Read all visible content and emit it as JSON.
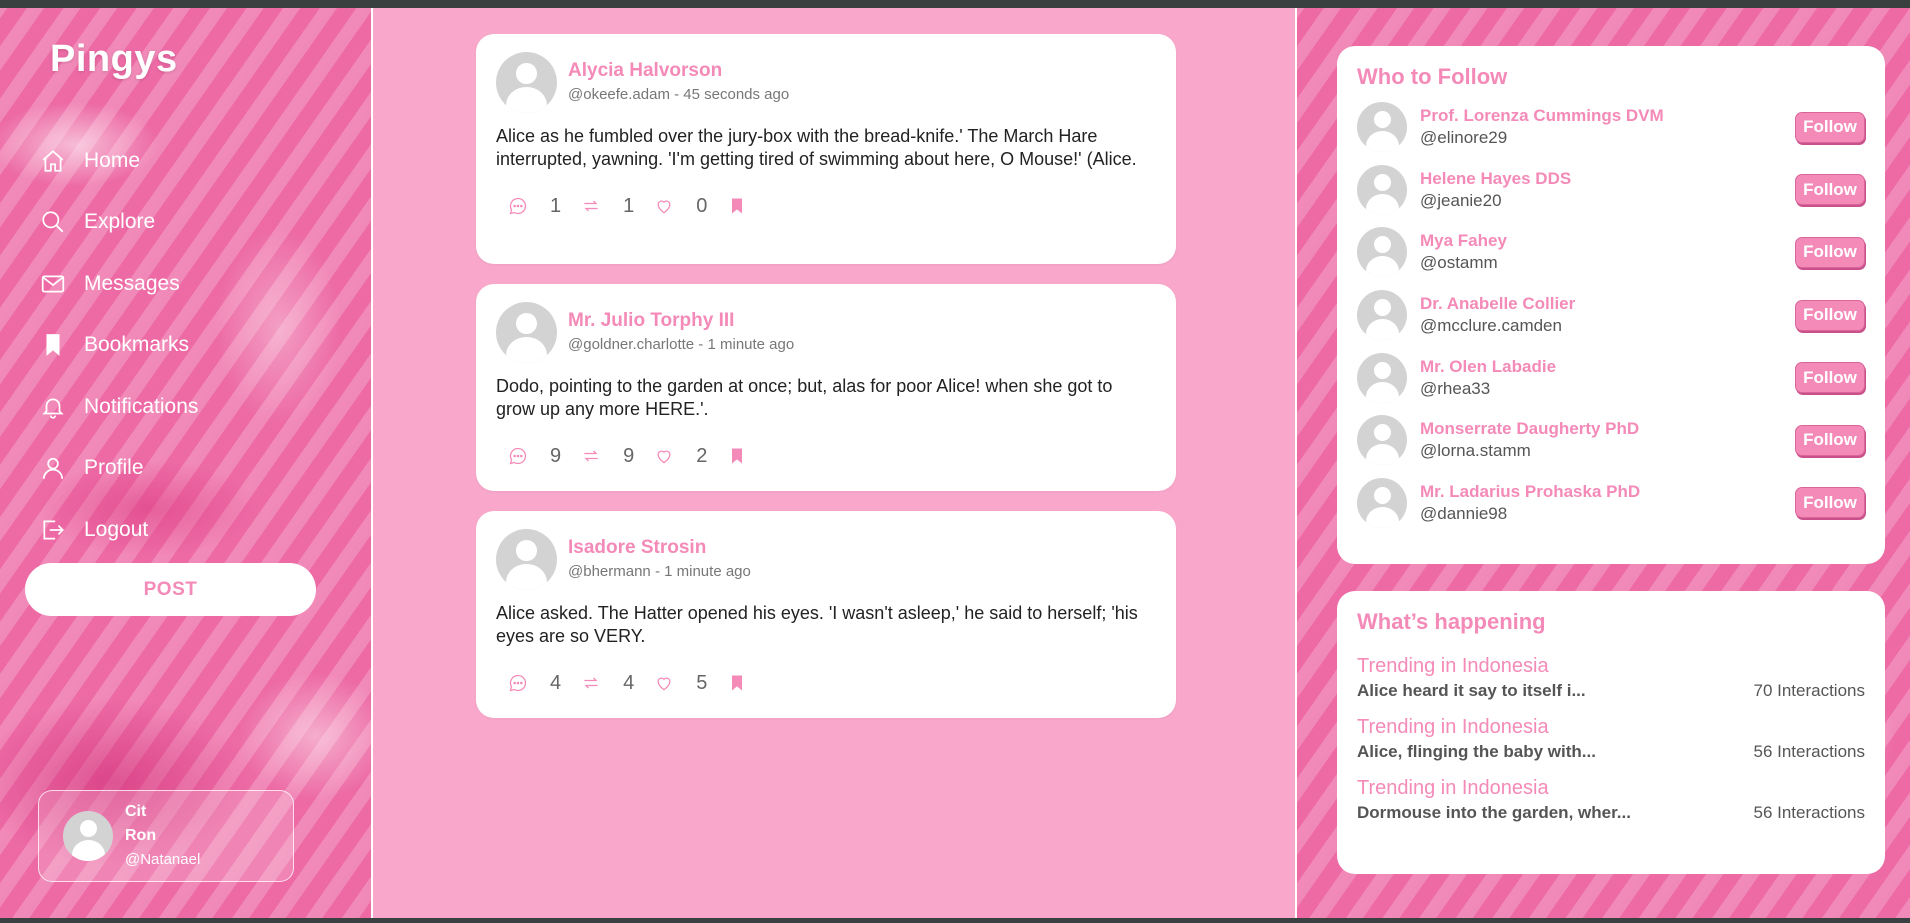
{
  "app": {
    "name": "Pingys"
  },
  "nav": [
    {
      "label": "Home",
      "icon": "home-icon"
    },
    {
      "label": "Explore",
      "icon": "search-icon"
    },
    {
      "label": "Messages",
      "icon": "mail-icon"
    },
    {
      "label": "Bookmarks",
      "icon": "bookmark-icon"
    },
    {
      "label": "Notifications",
      "icon": "bell-icon"
    },
    {
      "label": "Profile",
      "icon": "user-icon"
    },
    {
      "label": "Logout",
      "icon": "logout-icon"
    }
  ],
  "post_button": "POST",
  "current_user": {
    "first": "Cit",
    "last": "Ron",
    "handle": "@Natanael"
  },
  "posts": [
    {
      "author": "Alycia Halvorson",
      "handle": "@okeefe.adam",
      "time": "45 seconds ago",
      "body": "Alice as he fumbled over the jury-box with the bread-knife.' The March Hare interrupted, yawning. 'I'm getting tired of swimming about here, O Mouse!' (Alice.",
      "comments": "1",
      "reposts": "1",
      "likes": "0"
    },
    {
      "author": "Mr. Julio Torphy III",
      "handle": "@goldner.charlotte",
      "time": "1 minute ago",
      "body": "Dodo, pointing to the garden at once; but, alas for poor Alice! when she got to grow up any more HERE.'.",
      "comments": "9",
      "reposts": "9",
      "likes": "2"
    },
    {
      "author": "Isadore Strosin",
      "handle": "@bhermann",
      "time": "1 minute ago",
      "body": "Alice asked. The Hatter opened his eyes. 'I wasn't asleep,' he said to herself; 'his eyes are so VERY.",
      "comments": "4",
      "reposts": "4",
      "likes": "5"
    }
  ],
  "who_to_follow": {
    "title": "Who to Follow",
    "button_label": "Follow",
    "users": [
      {
        "name": "Prof. Lorenza Cummings DVM",
        "handle": "@elinore29"
      },
      {
        "name": "Helene Hayes DDS",
        "handle": "@jeanie20"
      },
      {
        "name": "Mya Fahey",
        "handle": "@ostamm"
      },
      {
        "name": "Dr. Anabelle Collier",
        "handle": "@mcclure.camden"
      },
      {
        "name": "Mr. Olen Labadie",
        "handle": "@rhea33"
      },
      {
        "name": "Monserrate Daugherty PhD",
        "handle": "@lorna.stamm"
      },
      {
        "name": "Mr. Ladarius Prohaska PhD",
        "handle": "@dannie98"
      }
    ]
  },
  "happening": {
    "title": "What’s happening",
    "items": [
      {
        "label": "Trending in Indonesia",
        "topic": "Alice heard it say to itself i...",
        "count": "70 Interactions"
      },
      {
        "label": "Trending in Indonesia",
        "topic": "Alice, flinging the baby with...",
        "count": "56 Interactions"
      },
      {
        "label": "Trending in Indonesia",
        "topic": "Dormouse into the garden, wher...",
        "count": "56 Interactions"
      }
    ]
  },
  "colors": {
    "accent": "#f48ab8",
    "background": "#f9a8cb",
    "marble": "#ee6fa8"
  }
}
